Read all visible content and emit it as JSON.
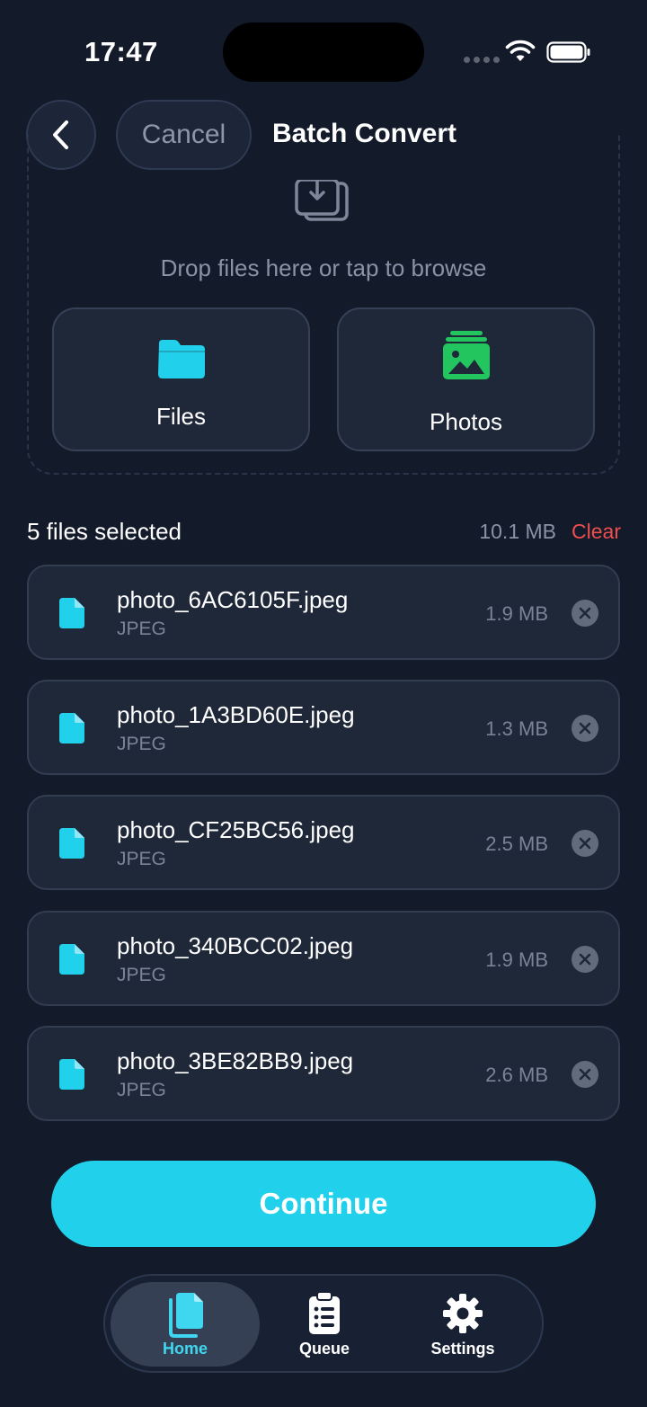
{
  "status_bar": {
    "time": "17:47"
  },
  "header": {
    "cancel_label": "Cancel",
    "title": "Batch Convert"
  },
  "drop_zone": {
    "hint": "Drop files here or tap to browse",
    "files_label": "Files",
    "photos_label": "Photos"
  },
  "selection": {
    "count_label": "5 files selected",
    "total_size": "10.1 MB",
    "clear_label": "Clear"
  },
  "files": [
    {
      "name": "photo_6AC6105F.jpeg",
      "type": "JPEG",
      "size": "1.9 MB"
    },
    {
      "name": "photo_1A3BD60E.jpeg",
      "type": "JPEG",
      "size": "1.3 MB"
    },
    {
      "name": "photo_CF25BC56.jpeg",
      "type": "JPEG",
      "size": "2.5 MB"
    },
    {
      "name": "photo_340BCC02.jpeg",
      "type": "JPEG",
      "size": "1.9 MB"
    },
    {
      "name": "photo_3BE82BB9.jpeg",
      "type": "JPEG",
      "size": "2.6 MB"
    }
  ],
  "continue_label": "Continue",
  "tabs": [
    {
      "label": "Home",
      "icon": "documents-icon",
      "active": true
    },
    {
      "label": "Queue",
      "icon": "clipboard-list-icon",
      "active": false
    },
    {
      "label": "Settings",
      "icon": "gear-icon",
      "active": false
    }
  ],
  "colors": {
    "background": "#131a2a",
    "accent": "#21d0ea",
    "photos_icon": "#22c55e",
    "danger": "#ef4e4e",
    "muted_text": "#8a93a6"
  }
}
